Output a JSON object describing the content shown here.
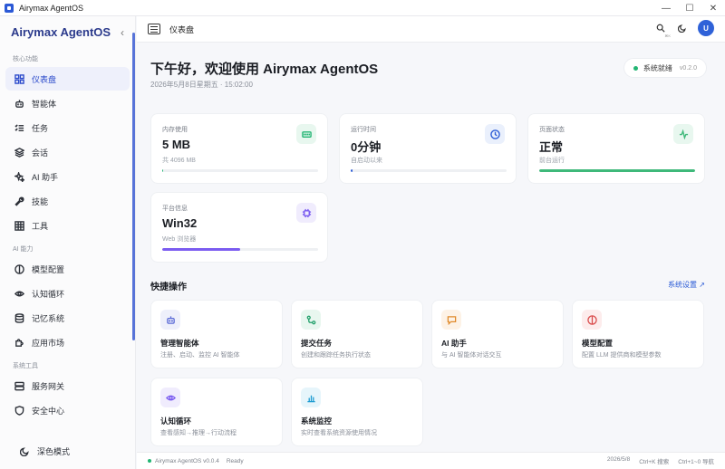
{
  "window": {
    "title": "Airymax AgentOS",
    "controls": [
      "—",
      "☐",
      "✕"
    ]
  },
  "sidebar": {
    "brand": "Airymax AgentOS",
    "collapse_glyph": "‹",
    "sections": [
      {
        "label": "核心功能",
        "items": [
          {
            "label": "仪表盘",
            "icon": "dashboard-icon"
          },
          {
            "label": "智能体",
            "icon": "robot-icon"
          },
          {
            "label": "任务",
            "icon": "task-list-icon"
          },
          {
            "label": "会话",
            "icon": "layers-icon"
          },
          {
            "label": "AI 助手",
            "icon": "sparkle-icon"
          },
          {
            "label": "技能",
            "icon": "wrench-icon"
          },
          {
            "label": "工具",
            "icon": "grid-icon"
          }
        ]
      },
      {
        "label": "AI 能力",
        "items": [
          {
            "label": "模型配置",
            "icon": "model-icon"
          },
          {
            "label": "认知循环",
            "icon": "eye-icon"
          },
          {
            "label": "记忆系统",
            "icon": "database-icon"
          },
          {
            "label": "应用市场",
            "icon": "puzzle-icon"
          }
        ]
      },
      {
        "label": "系统工具",
        "items": [
          {
            "label": "服务网关",
            "icon": "server-icon"
          },
          {
            "label": "安全中心",
            "icon": "shield-icon"
          }
        ]
      }
    ],
    "dark_mode_label": "深色模式"
  },
  "header": {
    "title": "仪表盘",
    "search_hint": "⌘K",
    "avatar": "U"
  },
  "main": {
    "greeting": "下午好，欢迎使用 Airymax AgentOS",
    "date": "2026年5月8日星期五 · 15:02:00",
    "status": {
      "label": "系统就绪",
      "version": "v0.2.0"
    },
    "stats": [
      {
        "label": "内存使用",
        "value": "5 MB",
        "sub": "共 4096 MB",
        "progress": 0.001,
        "color": "#22b573",
        "tint": "#e8f7ef",
        "icon": "memory-icon"
      },
      {
        "label": "运行时间",
        "value": "0分钟",
        "sub": "自启动以来",
        "progress": 0.01,
        "color": "#2b5bd6",
        "tint": "#eaf0fc",
        "icon": "clock-icon"
      },
      {
        "label": "页面状态",
        "value": "正常",
        "sub": "前台运行",
        "progress": 1.0,
        "color": "#3fb97a",
        "tint": "#e8f7ef",
        "icon": "activity-icon"
      },
      {
        "label": "平台信息",
        "value": "Win32",
        "sub": "Web 浏览器",
        "progress": 0.5,
        "color": "#7b5cf0",
        "tint": "#f0ecfd",
        "icon": "chip-icon"
      }
    ],
    "quick_title": "快捷操作",
    "quick_link": "系统设置 ↗",
    "quick_actions": [
      {
        "title": "管理智能体",
        "desc": "注册、启动、监控 AI 智能体",
        "icon": "robot-icon",
        "color": "#5b6bd6",
        "tint": "#eef0fb"
      },
      {
        "title": "提交任务",
        "desc": "创建和跟踪任务执行状态",
        "icon": "task-icon",
        "color": "#22a06b",
        "tint": "#e8f7ef"
      },
      {
        "title": "AI 助手",
        "desc": "与 AI 智能体对话交互",
        "icon": "chat-icon",
        "color": "#e08a2b",
        "tint": "#fdf2e6"
      },
      {
        "title": "模型配置",
        "desc": "配置 LLM 提供商和模型参数",
        "icon": "model-icon",
        "color": "#d94b4b",
        "tint": "#fdecec"
      },
      {
        "title": "认知循环",
        "desc": "查看感知→推理→行动流程",
        "icon": "eye-icon",
        "color": "#7b5cf0",
        "tint": "#f0ecfd"
      },
      {
        "title": "系统监控",
        "desc": "实时查看系统资源使用情况",
        "icon": "bar-chart-icon",
        "color": "#1b9bd1",
        "tint": "#e6f5fb"
      }
    ]
  },
  "footer": {
    "app": "Airymax AgentOS v0.0.4",
    "state": "Ready",
    "date": "2026/5/8",
    "shortcut1": "Ctrl+K 搜索",
    "shortcut2": "Ctrl+1~0 导航"
  }
}
